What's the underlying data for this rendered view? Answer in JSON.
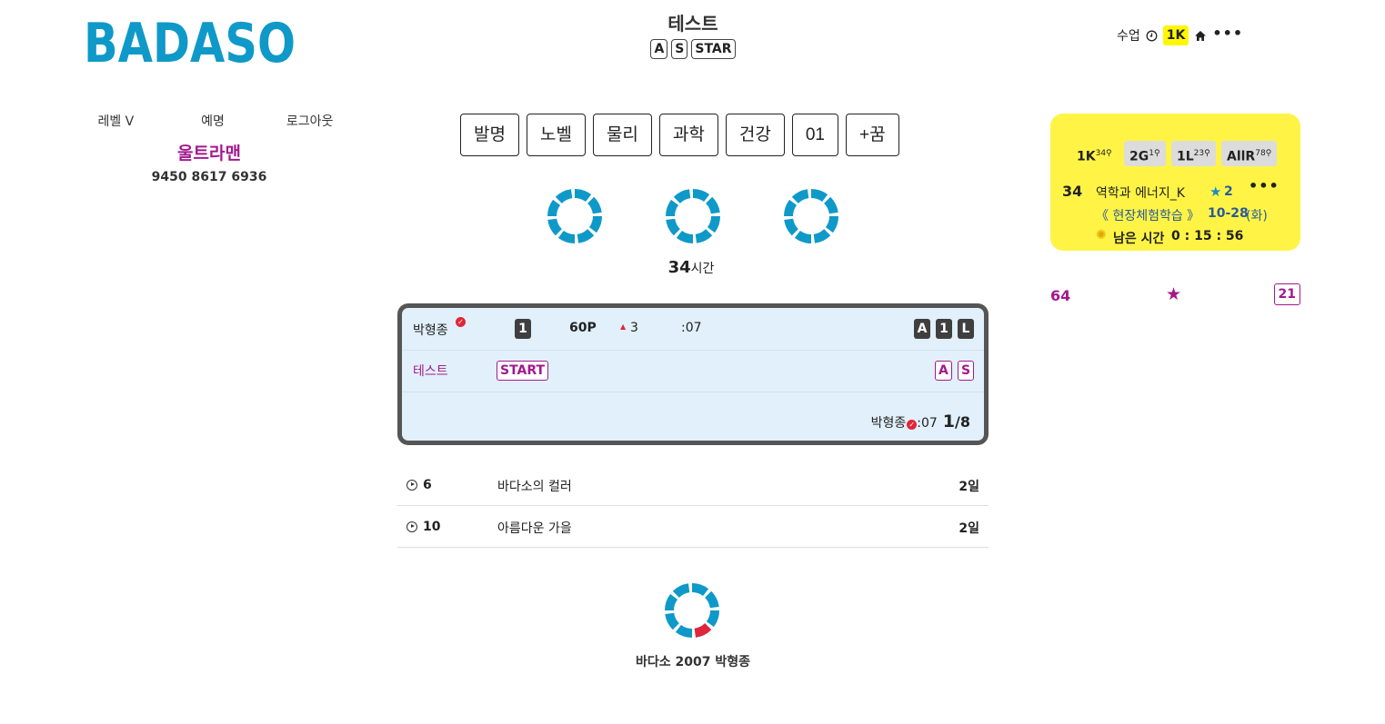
{
  "header": {
    "logo_text": "BADASO",
    "title": "테스트",
    "title_tags": [
      "A",
      "S",
      "STAR"
    ],
    "nav": {
      "class_label": "수업",
      "level_badge": "1K"
    }
  },
  "user": {
    "nav": [
      "레벨 V",
      "예명",
      "로그아웃"
    ],
    "name": "울트라맨",
    "phone": "9450 8617 6936"
  },
  "categories": [
    "발명",
    "노벨",
    "물리",
    "과학",
    "건강",
    "01",
    "+꿈"
  ],
  "hours": {
    "value": "34",
    "unit": "시간"
  },
  "card": {
    "player": "박형종",
    "level": "1",
    "points": "60P",
    "rank_up": "3",
    "time": ":07",
    "badges": [
      "A",
      "1",
      "L"
    ],
    "test_label": "테스트",
    "start_label": "START",
    "tags": [
      "A",
      "S"
    ],
    "footer_player": "박형종",
    "footer_time": ":07",
    "footer_count": "1",
    "footer_total": "/8"
  },
  "list": [
    {
      "number": "6",
      "title": "바다소의 컬러",
      "days": "2일"
    },
    {
      "number": "10",
      "title": "아름다운 가을",
      "days": "2일"
    }
  ],
  "footer": {
    "text": "바다소 2007 박형종"
  },
  "panel": {
    "tags": [
      {
        "label": "1K",
        "count": "34"
      },
      {
        "label": "2G",
        "count": "1"
      },
      {
        "label": "1L",
        "count": "23"
      },
      {
        "label": "AllR",
        "count": "78"
      }
    ],
    "course": {
      "number": "34",
      "title": "역학과 에너지_K",
      "stars": "2",
      "event": "《 현장체험학습 》",
      "date": "10-28",
      "weekday": "(화)",
      "remaining_label": "남은 시간",
      "remaining_time": "0 : 15 : 56"
    }
  },
  "stats": {
    "left": "64",
    "right": "21"
  },
  "colors": {
    "brand_blue": "#0f99c9",
    "magenta": "#a3198d",
    "yellow": "#fff446",
    "card_bg": "#e1f0fb",
    "alert_red": "#e0263a"
  }
}
